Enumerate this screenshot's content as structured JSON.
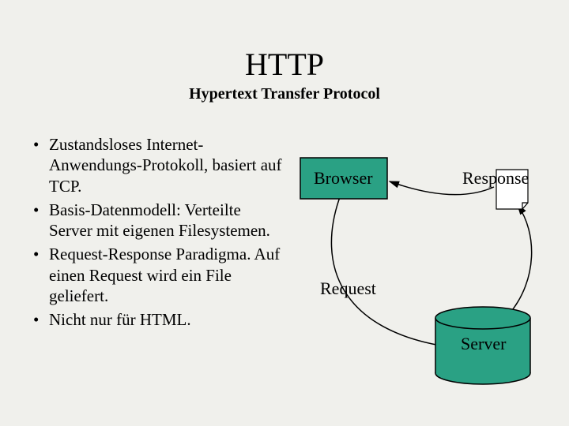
{
  "title": "HTTP",
  "subtitle": "Hypertext Transfer Protocol",
  "bullets": [
    "Zustandsloses Internet-Anwendungs-Protokoll, basiert auf TCP.",
    "Basis-Datenmodell: Verteilte Server mit eigenen Filesystemen.",
    "Request-Response Paradigma. Auf einen Request wird ein File geliefert.",
    "Nicht nur für  HTML."
  ],
  "diagram": {
    "browser_label": "Browser",
    "request_label": "Request",
    "response_label": "Response",
    "server_label": "Server",
    "colors": {
      "shape_fill": "#2aa184",
      "shape_stroke": "#000000",
      "page_fill": "#ffffff",
      "arrow_stroke": "#000000"
    }
  }
}
